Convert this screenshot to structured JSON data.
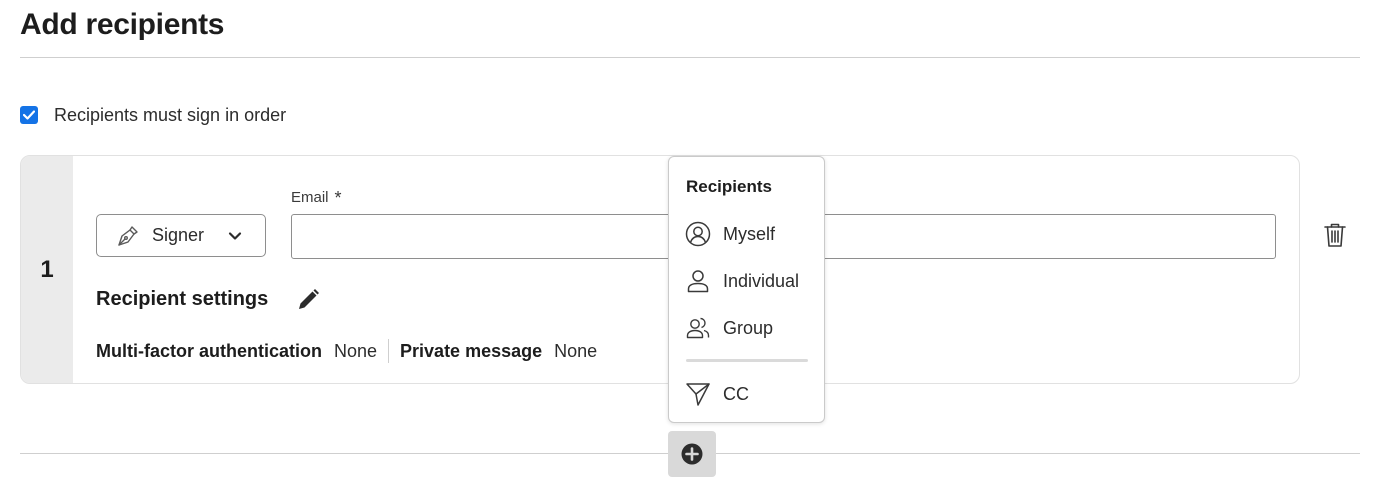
{
  "page": {
    "title": "Add recipients"
  },
  "order": {
    "label": "Recipients must sign in order",
    "checked": true
  },
  "recipient_card": {
    "index": "1",
    "role": {
      "label": "Signer",
      "icon": "pen-nib-icon"
    },
    "email": {
      "label": "Email",
      "required_marker": "*",
      "value": "",
      "placeholder": ""
    },
    "settings": {
      "title": "Recipient settings",
      "mfa_label": "Multi-factor authentication",
      "mfa_value": "None",
      "private_message_label": "Private message",
      "private_message_value": "None"
    }
  },
  "menu": {
    "title": "Recipients",
    "items": [
      {
        "label": "Myself",
        "icon": "user-circle-icon"
      },
      {
        "label": "Individual",
        "icon": "user-icon"
      },
      {
        "label": "Group",
        "icon": "users-icon"
      },
      {
        "label": "CC",
        "icon": "send-icon"
      }
    ]
  },
  "colors": {
    "accent": "#1473e6",
    "card_index_bg": "#ebebeb",
    "add_button_bg": "#d9d9d9"
  }
}
